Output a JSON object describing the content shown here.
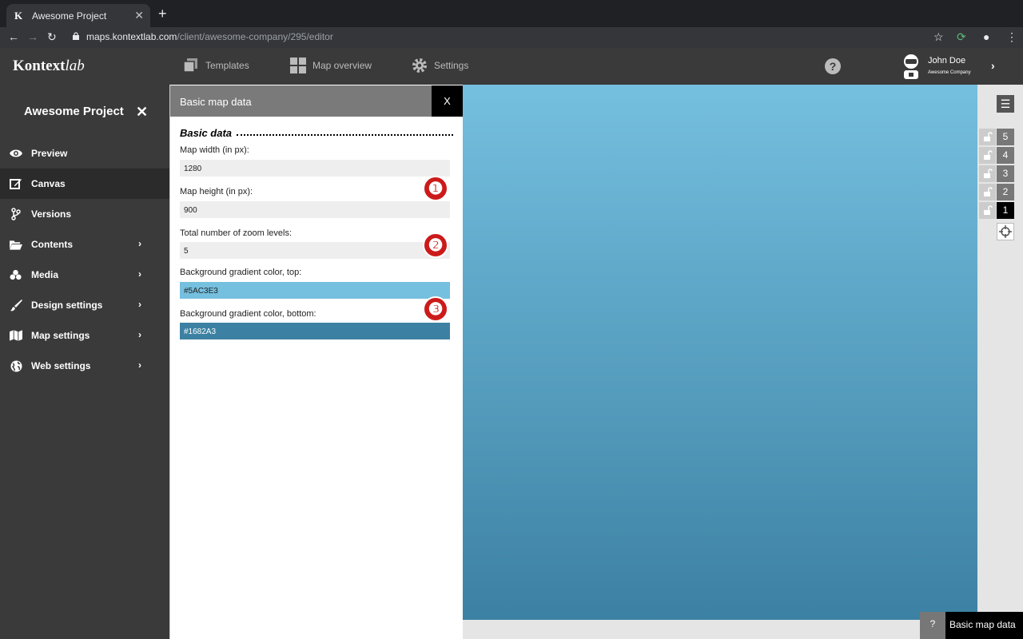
{
  "browser": {
    "tab_title": "Awesome Project",
    "favicon_letter": "K",
    "url_host": "maps.kontextlab.com",
    "url_path": "/client/awesome-company/295/editor"
  },
  "header": {
    "logo_main": "Kontext",
    "logo_italic": "lab",
    "nav": [
      {
        "label": "Templates",
        "icon": "templates-icon"
      },
      {
        "label": "Map overview",
        "icon": "map-overview-icon"
      },
      {
        "label": "Settings",
        "icon": "gear-icon"
      }
    ],
    "help_glyph": "?",
    "user": {
      "name": "John Doe",
      "company": "Awesome Company"
    }
  },
  "sidebar": {
    "project_title": "Awesome Project",
    "items": [
      {
        "label": "Preview",
        "icon": "eye-icon",
        "submenu": false,
        "active": false
      },
      {
        "label": "Canvas",
        "icon": "edit-icon",
        "submenu": false,
        "active": true
      },
      {
        "label": "Versions",
        "icon": "branch-icon",
        "submenu": false,
        "active": false
      },
      {
        "label": "Contents",
        "icon": "folder-icon",
        "submenu": true,
        "active": false
      },
      {
        "label": "Media",
        "icon": "media-icon",
        "submenu": true,
        "active": false
      },
      {
        "label": "Design settings",
        "icon": "brush-icon",
        "submenu": true,
        "active": false
      },
      {
        "label": "Map settings",
        "icon": "map-icon",
        "submenu": true,
        "active": false
      },
      {
        "label": "Web settings",
        "icon": "globe-icon",
        "submenu": true,
        "active": false
      }
    ]
  },
  "panel": {
    "title": "Basic map data",
    "close_label": "X",
    "section_title": "Basic data",
    "fields": {
      "width_label": "Map width (in px):",
      "width_value": "1280",
      "height_label": "Map height (in px):",
      "height_value": "900",
      "zoom_label": "Total number of zoom levels:",
      "zoom_value": "5",
      "top_label": "Background gradient color, top:",
      "top_value": "#5AC3E3",
      "bottom_label": "Background gradient color, bottom:",
      "bottom_value": "#1682A3"
    },
    "badges": [
      "❶",
      "❷",
      "❸"
    ]
  },
  "zoom_levels": [
    "5",
    "4",
    "3",
    "2",
    "1"
  ],
  "active_zoom_level": "1",
  "footer_help": {
    "q": "?",
    "label": "Basic map data"
  },
  "colors": {
    "sidebar_bg": "#3a3a3a",
    "gradient_top": "#75bfdf",
    "gradient_bottom": "#3c81a3",
    "badge_red": "#cc1a1a"
  }
}
